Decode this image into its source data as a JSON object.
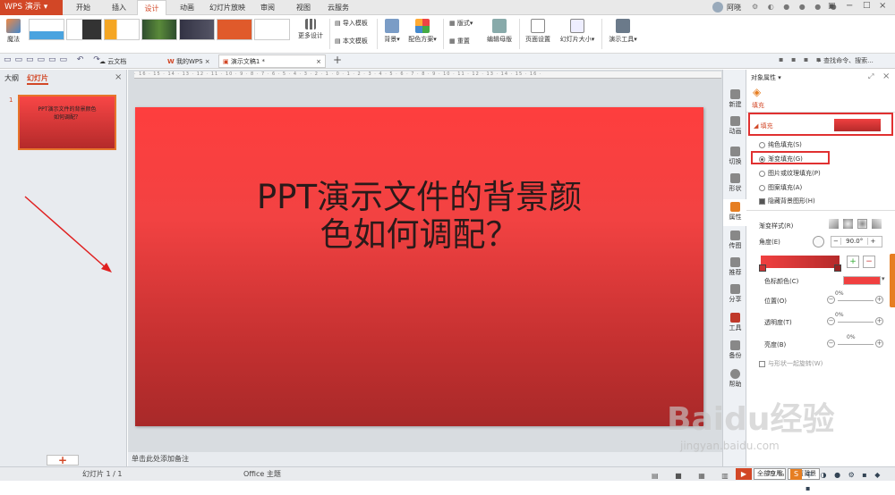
{
  "app": {
    "name": "WPS 演示"
  },
  "menu_tabs": [
    "开始",
    "插入",
    "设计",
    "动画",
    "幻灯片放映",
    "审阅",
    "视图",
    "云服务"
  ],
  "active_tab": "设计",
  "user": {
    "name": "阿晓"
  },
  "ribbon": {
    "magic_label": "魔法",
    "more_design": "更多设计",
    "import_template": "导入模板",
    "text_template": "本文模板",
    "background": "背景",
    "color_scheme": "配色方案",
    "layout": "版式",
    "reset": "重置",
    "edit_master": "编辑母版",
    "page_setup": "页面设置",
    "slide_size": "幻灯片大小",
    "demo_tools": "演示工具"
  },
  "quickbar": {
    "doc_tabs": [
      "云文档",
      "我的WPS",
      "演示文稿1 *"
    ],
    "active_doc": "演示文稿1 *",
    "search_placeholder": "查找命令、搜索..."
  },
  "left_panel": {
    "tabs": [
      "大纲",
      "幻灯片"
    ],
    "active": "幻灯片",
    "slide_number": "1",
    "slide_thumb_text": "PPT演示文件的背景颜色如何调配？"
  },
  "slide": {
    "title_line1": "PPT演示文件的背景颜",
    "title_line2": "色如何调配？",
    "gradient_top": "#fe3e3e",
    "gradient_bottom": "#a82929"
  },
  "notes_placeholder": "单击此处添加备注",
  "side_tools": [
    "新建",
    "动画",
    "切换",
    "形状",
    "属性",
    "传图",
    "推荐",
    "分享",
    "工具",
    "备份",
    "帮助"
  ],
  "active_side_tool": "属性",
  "properties": {
    "header": "对象属性",
    "fill_tab": "填充",
    "section": "填充",
    "options": [
      {
        "label": "纯色填充(S)",
        "selected": false
      },
      {
        "label": "渐变填充(G)",
        "selected": true
      },
      {
        "label": "图片或纹理填充(P)",
        "selected": false
      },
      {
        "label": "图案填充(A)",
        "selected": false
      }
    ],
    "hide_bg_shapes": "隐藏背景图形(H)",
    "gradient_style": "渐变样式(R)",
    "angle_label": "角度(E)",
    "angle_value": "90.0°",
    "stop_color_label": "色标颜色(C)",
    "position_label": "位置(O)",
    "transparency_label": "透明度(T)",
    "brightness_label": "亮度(B)",
    "position_value": "0%",
    "transparency_value": "0%",
    "brightness_value": "0%",
    "rotate_with_shape": "与形状一起旋转(W)",
    "stop_color": "#f04040"
  },
  "statusbar": {
    "slide_info": "幻灯片 1 / 1",
    "theme": "Office 主题",
    "apply_all": "全部应用",
    "reset_bg": "重置背景",
    "zoom": "79 %"
  },
  "watermark": {
    "main": "Baidu经验",
    "sub": "jingyan.baidu.com"
  }
}
